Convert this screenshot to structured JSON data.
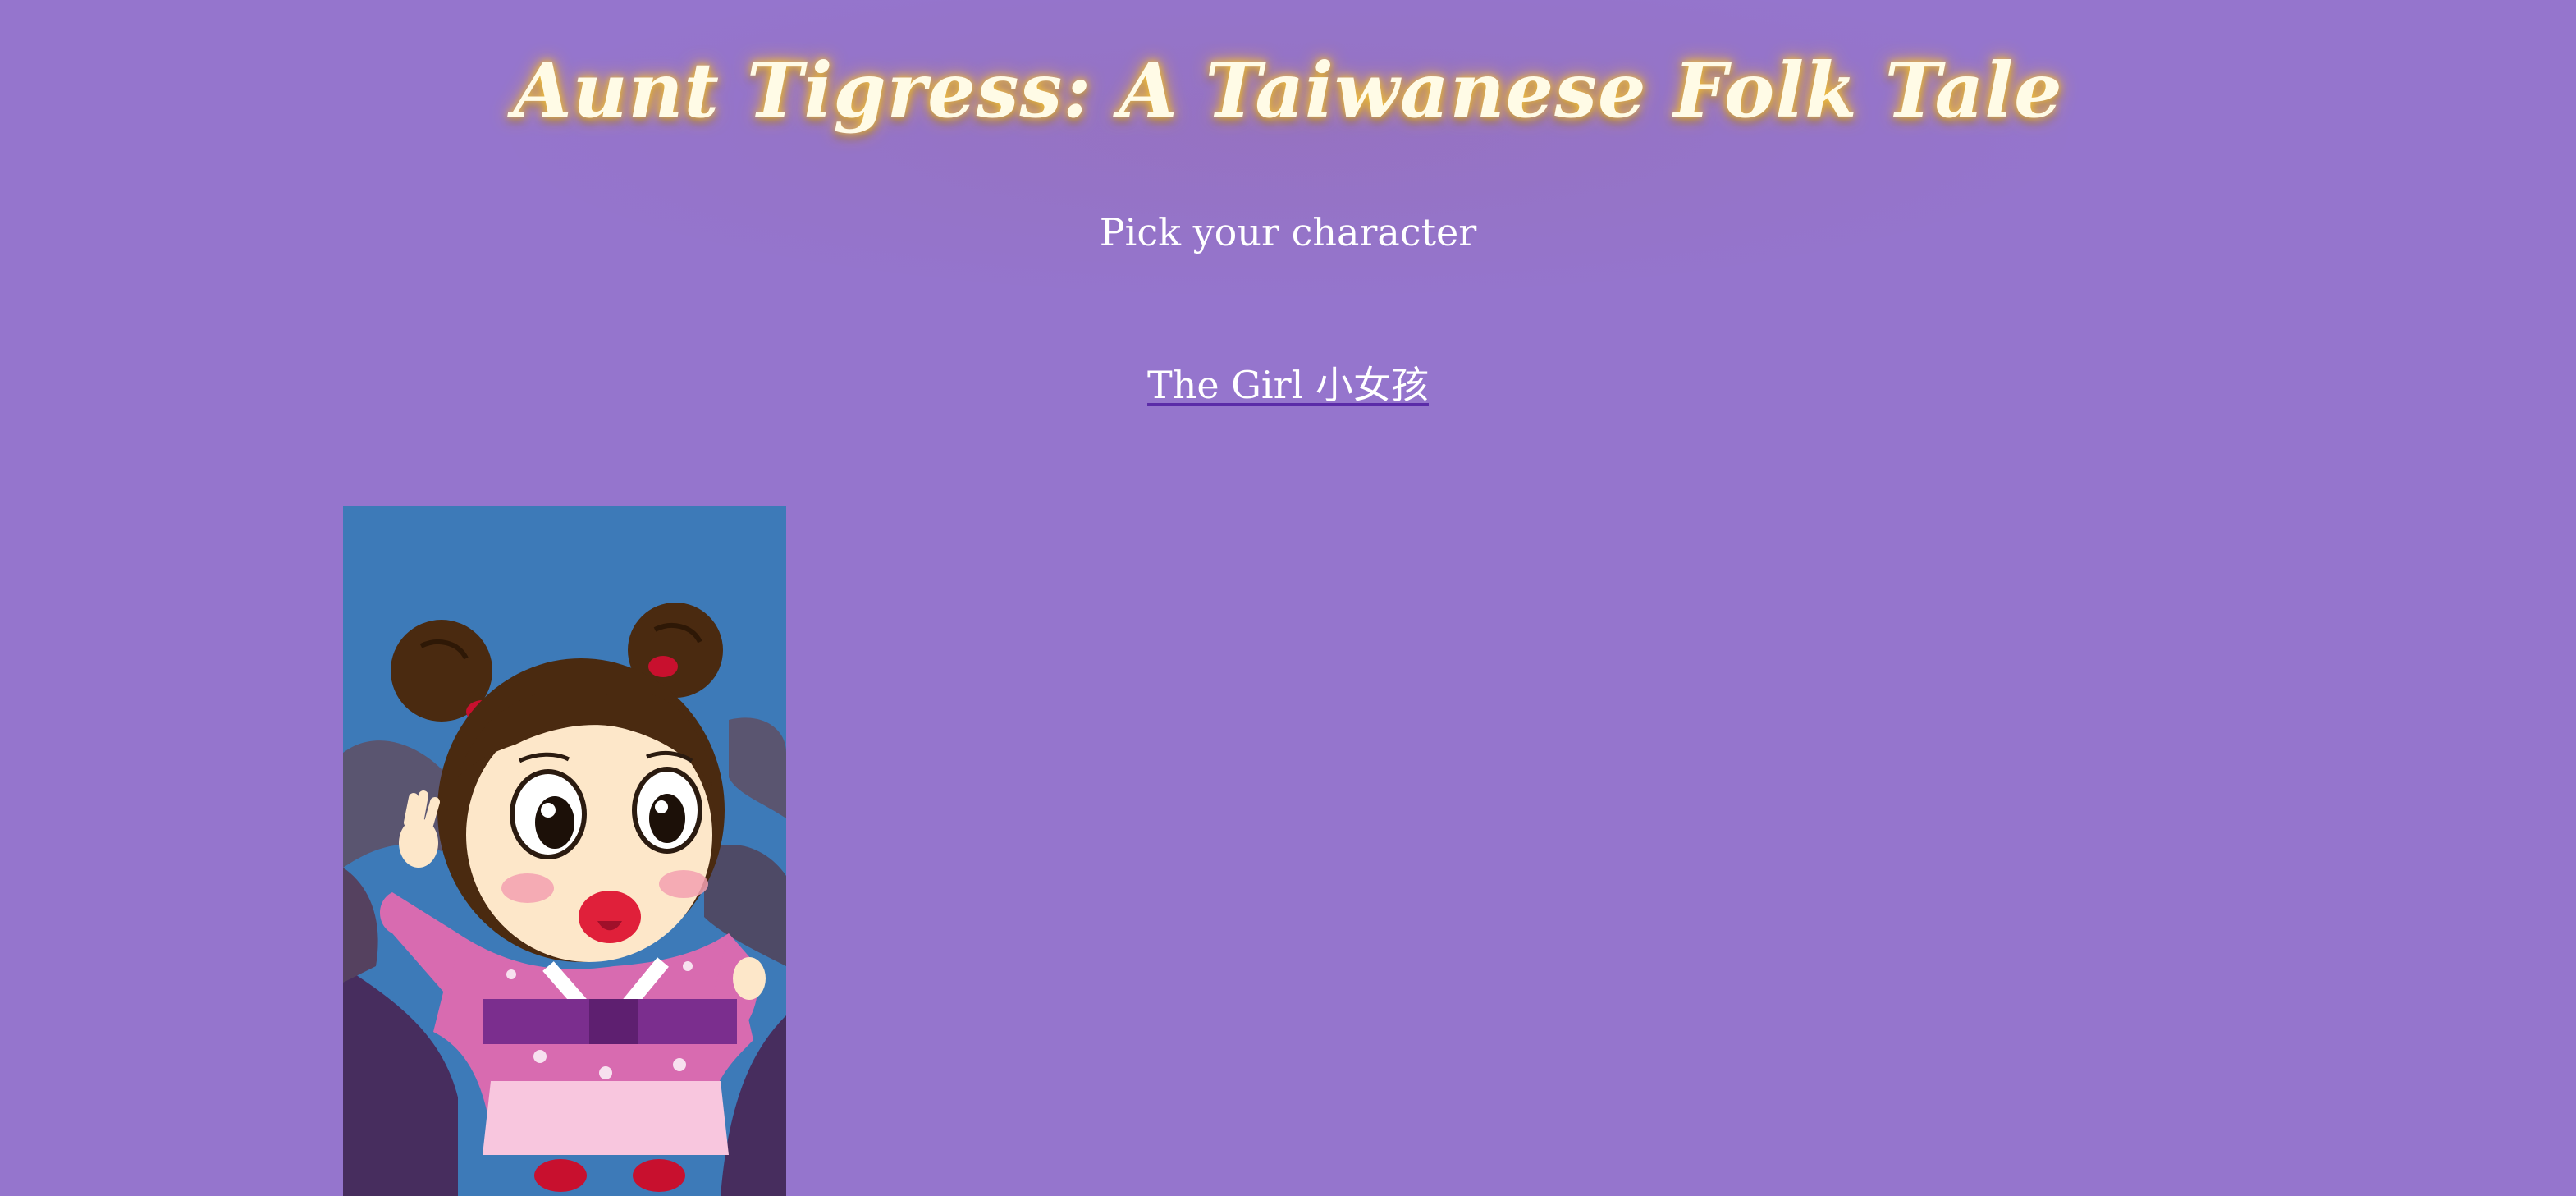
{
  "page": {
    "title": "Aunt Tigress: A Taiwanese Folk Tale",
    "subtitle": "Pick your character"
  },
  "characters": [
    {
      "label": "The Girl 小女孩",
      "image_icon": "girl-character-illustration"
    }
  ],
  "colors": {
    "background": "#9575cd",
    "title_text": "#fffbe6",
    "title_glow": "#f5c542",
    "link_underline": "#5b2ba8",
    "image_background": "#3d7ab8"
  }
}
